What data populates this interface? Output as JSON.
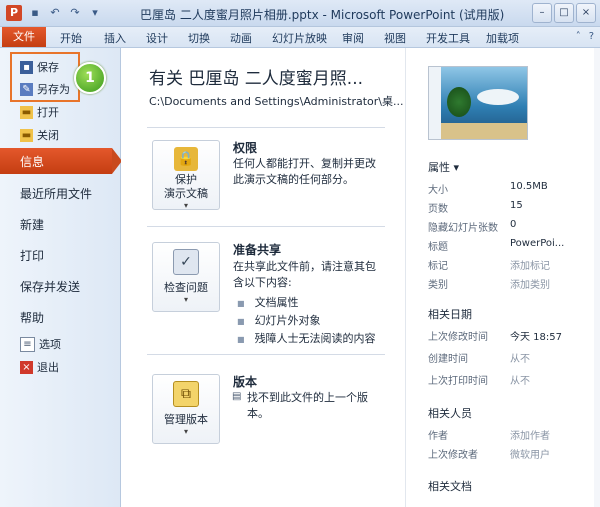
{
  "window": {
    "title": "巴厘岛 二人度蜜月照片相册.pptx - Microsoft PowerPoint (试用版)",
    "app_icon": "P",
    "controls": [
      "–",
      "□",
      "×"
    ]
  },
  "ribbon": {
    "file_tab": "文件",
    "tabs": [
      "开始",
      "插入",
      "设计",
      "切换",
      "动画",
      "幻灯片放映",
      "审阅",
      "视图",
      "开发工具",
      "加载项"
    ]
  },
  "nav": {
    "save": "保存",
    "save_as": "另存为",
    "open": "打开",
    "close": "关闭",
    "info": "信息",
    "recent": "最近所用文件",
    "new": "新建",
    "print": "打印",
    "save_send": "保存并发送",
    "help": "帮助",
    "options": "选项",
    "exit": "退出",
    "step_badge": "1"
  },
  "main": {
    "doc_title": "有关 巴厘岛 二人度蜜月照...",
    "doc_path": "C:\\Documents and Settings\\Administrator\\桌...",
    "permissions": {
      "button_line1": "保护",
      "button_line2": "演示文稿",
      "title": "权限",
      "desc": "任何人都能打开、复制并更改此演示文稿的任何部分。"
    },
    "share": {
      "button_line1": "检查问题",
      "title": "准备共享",
      "desc": "在共享此文件前，请注意其包含以下内容:",
      "items": [
        "文档属性",
        "幻灯片外对象",
        "残障人士无法阅读的内容"
      ]
    },
    "versions": {
      "button_line1": "管理版本",
      "title": "版本",
      "desc": "找不到此文件的上一个版本。"
    }
  },
  "properties": {
    "header": "属性 ▾",
    "rows": [
      {
        "k": "大小",
        "v": "10.5MB",
        "muted": false
      },
      {
        "k": "页数",
        "v": "15",
        "muted": false
      },
      {
        "k": "隐藏幻灯片张数",
        "v": "0",
        "muted": false
      },
      {
        "k": "标题",
        "v": "PowerPoi...",
        "muted": false
      },
      {
        "k": "标记",
        "v": "添加标记",
        "muted": true
      },
      {
        "k": "类别",
        "v": "添加类别",
        "muted": true
      }
    ],
    "dates_header": "相关日期",
    "dates": [
      {
        "k": "上次修改时间",
        "v": "今天 18:57",
        "muted": false
      },
      {
        "k": "创建时间",
        "v": "从不",
        "muted": true
      },
      {
        "k": "上次打印时间",
        "v": "从不",
        "muted": true
      }
    ],
    "people_header": "相关人员",
    "people": [
      {
        "k": "作者",
        "v": "添加作者",
        "muted": true
      },
      {
        "k": "上次修改者",
        "v": "微软用户",
        "muted": true
      }
    ],
    "docs_header": "相关文档"
  }
}
